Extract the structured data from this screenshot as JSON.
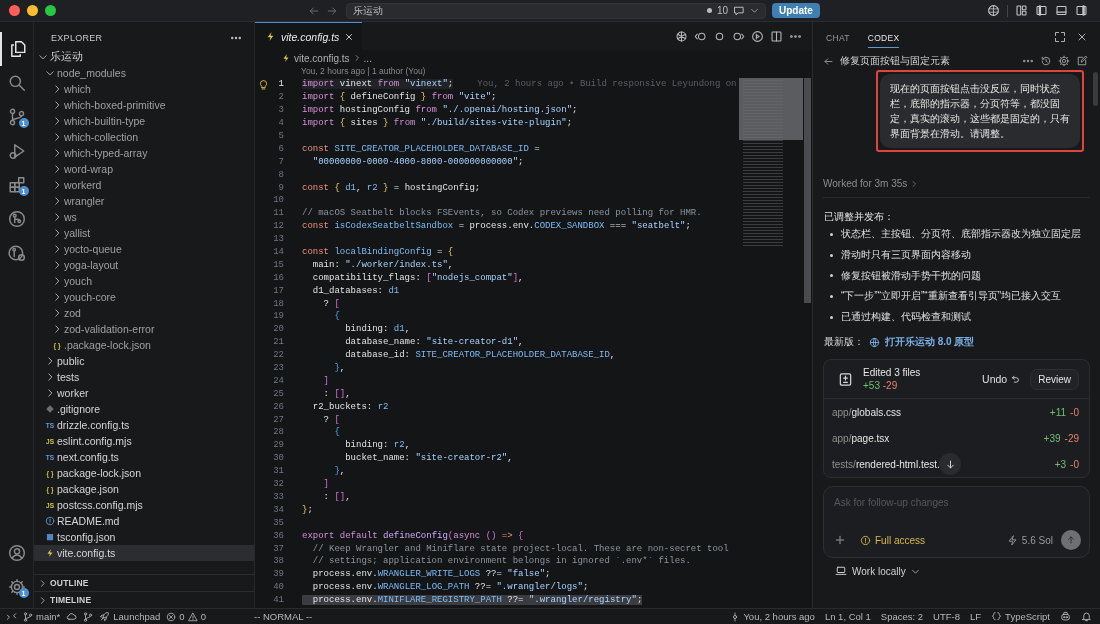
{
  "title_bar": {
    "search_text": "乐运动",
    "changes_count": "10",
    "update_button": "Update"
  },
  "activity_bar": {
    "items": [
      {
        "kind": "explorer",
        "selected": true
      },
      {
        "kind": "search",
        "selected": false
      },
      {
        "kind": "source-control",
        "selected": false,
        "badge": "1"
      },
      {
        "kind": "run-debug",
        "selected": false
      },
      {
        "kind": "extensions",
        "selected": false,
        "badge": "1"
      },
      {
        "kind": "graph",
        "selected": false
      },
      {
        "kind": "graph-search",
        "selected": false
      }
    ],
    "bottom": [
      {
        "kind": "account"
      },
      {
        "kind": "settings",
        "badge": "1"
      }
    ]
  },
  "explorer": {
    "title": "EXPLORER",
    "tree": [
      {
        "name": "乐运动",
        "kind": "folder",
        "expanded": true,
        "selected": false,
        "ignored": false,
        "children": [
          {
            "name": "node_modules",
            "kind": "folder",
            "expanded": true,
            "selected": false,
            "ignored": true,
            "children": [
              {
                "name": "which",
                "kind": "folder",
                "expanded": false,
                "selected": false,
                "ignored": true
              },
              {
                "name": "which-boxed-primitive",
                "kind": "folder",
                "expanded": false,
                "selected": false,
                "ignored": true
              },
              {
                "name": "which-builtin-type",
                "kind": "folder",
                "expanded": false,
                "selected": false,
                "ignored": true
              },
              {
                "name": "which-collection",
                "kind": "folder",
                "expanded": false,
                "selected": false,
                "ignored": true
              },
              {
                "name": "which-typed-array",
                "kind": "folder",
                "expanded": false,
                "selected": false,
                "ignored": true
              },
              {
                "name": "word-wrap",
                "kind": "folder",
                "expanded": false,
                "selected": false,
                "ignored": true
              },
              {
                "name": "workerd",
                "kind": "folder",
                "expanded": false,
                "selected": false,
                "ignored": true
              },
              {
                "name": "wrangler",
                "kind": "folder",
                "expanded": false,
                "selected": false,
                "ignored": true
              },
              {
                "name": "ws",
                "kind": "folder",
                "expanded": false,
                "selected": false,
                "ignored": true
              },
              {
                "name": "yallist",
                "kind": "folder",
                "expanded": false,
                "selected": false,
                "ignored": true
              },
              {
                "name": "yocto-queue",
                "kind": "folder",
                "expanded": false,
                "selected": false,
                "ignored": true
              },
              {
                "name": "yoga-layout",
                "kind": "folder",
                "expanded": false,
                "selected": false,
                "ignored": true
              },
              {
                "name": "youch",
                "kind": "folder",
                "expanded": false,
                "selected": false,
                "ignored": true
              },
              {
                "name": "youch-core",
                "kind": "folder",
                "expanded": false,
                "selected": false,
                "ignored": true
              },
              {
                "name": "zod",
                "kind": "folder",
                "expanded": false,
                "selected": false,
                "ignored": true
              },
              {
                "name": "zod-validation-error",
                "kind": "folder",
                "expanded": false,
                "selected": false,
                "ignored": true
              },
              {
                "name": ".package-lock.json",
                "kind": "json",
                "type_label": "{ }",
                "selected": false,
                "ignored": true
              }
            ]
          },
          {
            "name": "public",
            "kind": "folder",
            "expanded": false,
            "selected": false,
            "ignored": false
          },
          {
            "name": "tests",
            "kind": "folder",
            "expanded": false,
            "selected": false,
            "ignored": false
          },
          {
            "name": "worker",
            "kind": "folder",
            "expanded": false,
            "selected": false,
            "ignored": false
          },
          {
            "name": ".gitignore",
            "kind": "git",
            "selected": false,
            "ignored": false
          },
          {
            "name": "drizzle.config.ts",
            "kind": "ts",
            "type_label": "TS",
            "selected": false,
            "ignored": false
          },
          {
            "name": "eslint.config.mjs",
            "kind": "js",
            "type_label": "JS",
            "selected": false,
            "ignored": false
          },
          {
            "name": "next.config.ts",
            "kind": "ts",
            "type_label": "TS",
            "selected": false,
            "ignored": false
          },
          {
            "name": "package-lock.json",
            "kind": "json",
            "type_label": "{ }",
            "selected": false,
            "ignored": false
          },
          {
            "name": "package.json",
            "kind": "json",
            "type_label": "{ }",
            "selected": false,
            "ignored": false
          },
          {
            "name": "postcss.config.mjs",
            "kind": "js",
            "type_label": "JS",
            "selected": false,
            "ignored": false
          },
          {
            "name": "README.md",
            "kind": "info",
            "selected": false,
            "ignored": false
          },
          {
            "name": "tsconfig.json",
            "kind": "tsconfig",
            "selected": false,
            "ignored": false
          },
          {
            "name": "vite.config.ts",
            "kind": "vite",
            "selected": true,
            "ignored": false
          }
        ]
      }
    ],
    "sections": [
      {
        "label": "OUTLINE",
        "expanded": false
      },
      {
        "label": "TIMELINE",
        "expanded": false
      }
    ]
  },
  "editor": {
    "tabs": [
      {
        "label": "vite.config.ts",
        "selected": true
      }
    ],
    "breadcrumb": [
      "vite.config.ts",
      "..."
    ],
    "codelens": "You, 2 hours ago | 1 author (You)",
    "lines": [
      {
        "number": "1",
        "cursor": true,
        "selected": false,
        "tokens": [
          {
            "text": "import",
            "kind": "keyword"
          },
          {
            "text": " vinext ",
            "kind": "plain"
          },
          {
            "text": "from ",
            "kind": "keyword"
          },
          {
            "text": "\"vinext\"",
            "kind": "string"
          },
          {
            "text": ";",
            "kind": "plain"
          }
        ],
        "blame": "You, 2 hours ago • Build responsive Leyundong on"
      },
      {
        "number": "2",
        "cursor": false,
        "selected": false,
        "tokens": [
          {
            "text": "import ",
            "kind": "keyword"
          },
          {
            "text": "{",
            "kind": "brace"
          },
          {
            "text": " defineConfig ",
            "kind": "plain"
          },
          {
            "text": "} ",
            "kind": "brace"
          },
          {
            "text": "from ",
            "kind": "keyword"
          },
          {
            "text": "\"vite\"",
            "kind": "string"
          },
          {
            "text": ";",
            "kind": "plain"
          }
        ]
      },
      {
        "number": "3",
        "cursor": false,
        "selected": false,
        "tokens": [
          {
            "text": "import",
            "kind": "keyword"
          },
          {
            "text": " hostingConfig ",
            "kind": "plain"
          },
          {
            "text": "from ",
            "kind": "keyword"
          },
          {
            "text": "\"./.openai/hosting.json\"",
            "kind": "string"
          },
          {
            "text": ";",
            "kind": "plain"
          }
        ]
      },
      {
        "number": "4",
        "cursor": false,
        "selected": false,
        "tokens": [
          {
            "text": "import ",
            "kind": "keyword"
          },
          {
            "text": "{",
            "kind": "brace"
          },
          {
            "text": " sites ",
            "kind": "plain"
          },
          {
            "text": "} ",
            "kind": "brace"
          },
          {
            "text": "from ",
            "kind": "keyword"
          },
          {
            "text": "\"./build/sites-vite-plugin\"",
            "kind": "string"
          },
          {
            "text": ";",
            "kind": "plain"
          }
        ]
      },
      {
        "number": "5",
        "cursor": false,
        "selected": false
      },
      {
        "number": "6",
        "cursor": false,
        "selected": false,
        "tokens": [
          {
            "text": "const ",
            "kind": "storage"
          },
          {
            "text": "SITE_CREATOR_PLACEHOLDER_DATABASE_ID",
            "kind": "name"
          },
          {
            "text": " =",
            "kind": "plain"
          }
        ]
      },
      {
        "number": "7",
        "cursor": false,
        "selected": false,
        "tokens": [
          {
            "text": "  \"00000000-0000-4000-8000-000000000000\"",
            "kind": "string"
          },
          {
            "text": ";",
            "kind": "plain"
          }
        ]
      },
      {
        "number": "8",
        "cursor": false,
        "selected": false
      },
      {
        "number": "9",
        "cursor": false,
        "selected": false,
        "tokens": [
          {
            "text": "const ",
            "kind": "storage"
          },
          {
            "text": "{ ",
            "kind": "brace"
          },
          {
            "text": "d1",
            "kind": "name"
          },
          {
            "text": ", ",
            "kind": "plain"
          },
          {
            "text": "r2 ",
            "kind": "name"
          },
          {
            "text": "}",
            "kind": "brace"
          },
          {
            "text": " = hostingConfig;",
            "kind": "plain"
          }
        ]
      },
      {
        "number": "10",
        "cursor": false,
        "selected": false
      },
      {
        "number": "11",
        "cursor": false,
        "selected": false,
        "tokens": [
          {
            "text": "// macOS Seatbelt blocks FSEvents, so Codex previews need polling for HMR.",
            "kind": "comment"
          }
        ]
      },
      {
        "number": "12",
        "cursor": false,
        "selected": false,
        "tokens": [
          {
            "text": "const ",
            "kind": "storage"
          },
          {
            "text": "isCodexSeatbeltSandbox",
            "kind": "name"
          },
          {
            "text": " = process.env.",
            "kind": "plain"
          },
          {
            "text": "CODEX_SANDBOX",
            "kind": "name"
          },
          {
            "text": " === ",
            "kind": "plain"
          },
          {
            "text": "\"seatbelt\"",
            "kind": "string"
          },
          {
            "text": ";",
            "kind": "plain"
          }
        ]
      },
      {
        "number": "13",
        "cursor": false,
        "selected": false
      },
      {
        "number": "14",
        "cursor": false,
        "selected": false,
        "tokens": [
          {
            "text": "const ",
            "kind": "storage"
          },
          {
            "text": "localBindingConfig",
            "kind": "name"
          },
          {
            "text": " = ",
            "kind": "plain"
          },
          {
            "text": "{",
            "kind": "brace"
          }
        ]
      },
      {
        "number": "15",
        "cursor": false,
        "selected": false,
        "tokens": [
          {
            "text": "  main: ",
            "kind": "plain"
          },
          {
            "text": "\"./worker/index.ts\"",
            "kind": "string"
          },
          {
            "text": ",",
            "kind": "plain"
          }
        ]
      },
      {
        "number": "16",
        "cursor": false,
        "selected": false,
        "tokens": [
          {
            "text": "  compatibility_flags: ",
            "kind": "plain"
          },
          {
            "text": "[",
            "kind": "bracket"
          },
          {
            "text": "\"nodejs_compat\"",
            "kind": "string"
          },
          {
            "text": "]",
            "kind": "bracket"
          },
          {
            "text": ",",
            "kind": "plain"
          }
        ]
      },
      {
        "number": "17",
        "cursor": false,
        "selected": false,
        "tokens": [
          {
            "text": "  d1_databases: ",
            "kind": "plain"
          },
          {
            "text": "d1",
            "kind": "name"
          }
        ]
      },
      {
        "number": "18",
        "cursor": false,
        "selected": false,
        "tokens": [
          {
            "text": "    ? ",
            "kind": "plain"
          },
          {
            "text": "[",
            "kind": "bracket"
          }
        ]
      },
      {
        "number": "19",
        "cursor": false,
        "selected": false,
        "tokens": [
          {
            "text": "      {",
            "kind": "brace2"
          }
        ]
      },
      {
        "number": "20",
        "cursor": false,
        "selected": false,
        "tokens": [
          {
            "text": "        binding: ",
            "kind": "plain"
          },
          {
            "text": "d1",
            "kind": "name"
          },
          {
            "text": ",",
            "kind": "plain"
          }
        ]
      },
      {
        "number": "21",
        "cursor": false,
        "selected": false,
        "tokens": [
          {
            "text": "        database_name: ",
            "kind": "plain"
          },
          {
            "text": "\"site-creator-d1\"",
            "kind": "string"
          },
          {
            "text": ",",
            "kind": "plain"
          }
        ]
      },
      {
        "number": "22",
        "cursor": false,
        "selected": false,
        "tokens": [
          {
            "text": "        database_id: ",
            "kind": "plain"
          },
          {
            "text": "SITE_CREATOR_PLACEHOLDER_DATABASE_ID",
            "kind": "name"
          },
          {
            "text": ",",
            "kind": "plain"
          }
        ]
      },
      {
        "number": "23",
        "cursor": false,
        "selected": false,
        "tokens": [
          {
            "text": "      }",
            "kind": "brace2"
          },
          {
            "text": ",",
            "kind": "plain"
          }
        ]
      },
      {
        "number": "24",
        "cursor": false,
        "selected": false,
        "tokens": [
          {
            "text": "    ]",
            "kind": "bracket"
          }
        ]
      },
      {
        "number": "25",
        "cursor": false,
        "selected": false,
        "tokens": [
          {
            "text": "    : ",
            "kind": "plain"
          },
          {
            "text": "[]",
            "kind": "bracket"
          },
          {
            "text": ",",
            "kind": "plain"
          }
        ]
      },
      {
        "number": "26",
        "cursor": false,
        "selected": false,
        "tokens": [
          {
            "text": "  r2_buckets: ",
            "kind": "plain"
          },
          {
            "text": "r2",
            "kind": "name"
          }
        ]
      },
      {
        "number": "27",
        "cursor": false,
        "selected": false,
        "tokens": [
          {
            "text": "    ? ",
            "kind": "plain"
          },
          {
            "text": "[",
            "kind": "bracket"
          }
        ]
      },
      {
        "number": "28",
        "cursor": false,
        "selected": false,
        "tokens": [
          {
            "text": "      {",
            "kind": "brace2"
          }
        ]
      },
      {
        "number": "29",
        "cursor": false,
        "selected": false,
        "tokens": [
          {
            "text": "        binding: ",
            "kind": "plain"
          },
          {
            "text": "r2",
            "kind": "name"
          },
          {
            "text": ",",
            "kind": "plain"
          }
        ]
      },
      {
        "number": "30",
        "cursor": false,
        "selected": false,
        "tokens": [
          {
            "text": "        bucket_name: ",
            "kind": "plain"
          },
          {
            "text": "\"site-creator-r2\"",
            "kind": "string"
          },
          {
            "text": ",",
            "kind": "plain"
          }
        ]
      },
      {
        "number": "31",
        "cursor": false,
        "selected": false,
        "tokens": [
          {
            "text": "      }",
            "kind": "brace2"
          },
          {
            "text": ",",
            "kind": "plain"
          }
        ]
      },
      {
        "number": "32",
        "cursor": false,
        "selected": false,
        "tokens": [
          {
            "text": "    ]",
            "kind": "bracket"
          }
        ]
      },
      {
        "number": "33",
        "cursor": false,
        "selected": false,
        "tokens": [
          {
            "text": "    : ",
            "kind": "plain"
          },
          {
            "text": "[]",
            "kind": "bracket"
          },
          {
            "text": ",",
            "kind": "plain"
          }
        ]
      },
      {
        "number": "34",
        "cursor": false,
        "selected": false,
        "tokens": [
          {
            "text": "}",
            "kind": "brace"
          },
          {
            "text": ";",
            "kind": "plain"
          }
        ]
      },
      {
        "number": "35",
        "cursor": false,
        "selected": false
      },
      {
        "number": "36",
        "cursor": false,
        "selected": false,
        "tokens": [
          {
            "text": "export ",
            "kind": "keyword"
          },
          {
            "text": "default ",
            "kind": "keyword"
          },
          {
            "text": "defineConfig",
            "kind": "function"
          },
          {
            "text": "(",
            "kind": "bracket"
          },
          {
            "text": "async ",
            "kind": "keyword"
          },
          {
            "text": "() ",
            "kind": "bracket"
          },
          {
            "text": "=> ",
            "kind": "operator"
          },
          {
            "text": "{",
            "kind": "bracket"
          }
        ]
      },
      {
        "number": "37",
        "cursor": false,
        "selected": false,
        "tokens": [
          {
            "text": "  // Keep Wrangler and Miniflare state project-local. These are non-secret tool",
            "kind": "comment"
          }
        ]
      },
      {
        "number": "38",
        "cursor": false,
        "selected": false,
        "tokens": [
          {
            "text": "  // settings; application environment belongs in ignored `.env*` files.",
            "kind": "comment"
          }
        ]
      },
      {
        "number": "39",
        "cursor": false,
        "selected": false,
        "tokens": [
          {
            "text": "  process.env.",
            "kind": "plain"
          },
          {
            "text": "WRANGLER_WRITE_LOGS",
            "kind": "name"
          },
          {
            "text": " ??= ",
            "kind": "plain"
          },
          {
            "text": "\"false\"",
            "kind": "string"
          },
          {
            "text": ";",
            "kind": "plain"
          }
        ]
      },
      {
        "number": "40",
        "cursor": false,
        "selected": false,
        "tokens": [
          {
            "text": "  process.env.",
            "kind": "plain"
          },
          {
            "text": "WRANGLER_LOG_PATH",
            "kind": "name"
          },
          {
            "text": " ??= ",
            "kind": "plain"
          },
          {
            "text": "\".wrangler/logs\"",
            "kind": "string"
          },
          {
            "text": ";",
            "kind": "plain"
          }
        ]
      },
      {
        "number": "41",
        "cursor": false,
        "selected": true,
        "tokens": [
          {
            "text": "  process.env.",
            "kind": "plain"
          },
          {
            "text": "MINIFLARE_REGISTRY_PATH",
            "kind": "name"
          },
          {
            "text": " ??= ",
            "kind": "plain"
          },
          {
            "text": "\".wrangler/registry\"",
            "kind": "string"
          },
          {
            "text": ";",
            "kind": "plain"
          }
        ]
      }
    ]
  },
  "codex": {
    "tabs": [
      {
        "label": "CHAT",
        "selected": false
      },
      {
        "label": "CODEX",
        "selected": true
      }
    ],
    "thread_title": "修复页面按钮与固定元素",
    "user_message": "现在的页面按钮点击没反应，同时状态栏，底部的指示器，分页符等，都没固定，真实的滚动，这些都是固定的，只有界面背景在滑动。请调整。",
    "message_outlined": true,
    "worked_for": "Worked for 3m 35s",
    "summary_heading": "已调整并发布：",
    "bullets": [
      "状态栏、主按钮、分页符、底部指示器改为独立固定层",
      "滑动时只有三页界面内容移动",
      "修复按钮被滑动手势干扰的问题",
      "“下一步”“立即开启”“重新查看引导页”均已接入交互",
      "已通过构建、代码检查和测试"
    ],
    "latest_label": "最新版：",
    "latest_link": "打开乐运动 8.0 原型",
    "edits": {
      "title": "Edited 3 files",
      "added": "+53",
      "removed": "-29",
      "undo": "Undo",
      "review": "Review",
      "files": [
        {
          "path": "app/globals.css",
          "added": "+11",
          "removed": "-0"
        },
        {
          "path": "app/page.tsx",
          "added": "+39",
          "removed": "-29"
        },
        {
          "path": "tests/rendered-html.test.",
          "added": "+3",
          "removed": "-0"
        }
      ]
    },
    "composer": {
      "placeholder": "Ask for follow-up changes",
      "access": "Full access",
      "model": "5.6 Sol"
    },
    "work_mode": "Work locally"
  },
  "status_bar": {
    "branch": "main*",
    "launchpad": "Launchpad",
    "errors": "0",
    "warnings": "0",
    "mode": "-- NORMAL --",
    "blame": "You, 2 hours ago",
    "position": "Ln 1, Col 1",
    "indent": "Spaces: 2",
    "encoding": "UTF-8",
    "eol": "LF",
    "language": "TypeScript"
  }
}
